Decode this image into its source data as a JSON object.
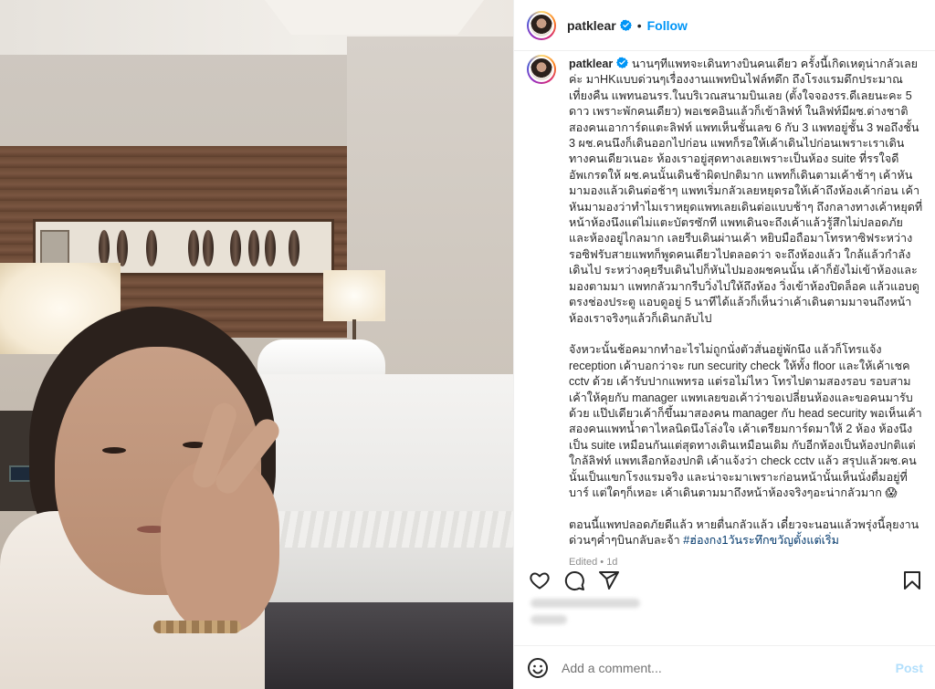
{
  "post": {
    "username": "patklear",
    "follow_label": "Follow",
    "separator": "•",
    "caption_paragraph_1": "นานๆทีแพทจะเดินทางบินคนเดียว ครั้งนี้เกิดเหตุน่ากลัวเลยค่ะ มาHKแบบด่วนๆเรื่องงานแพทบินไฟล์ทดึก ถึงโรงแรมดึกประมาณเที่ยงคืน แพทนอนรร.ในบริเวณสนามบินเลย (ตั้งใจจองรร.ดีเลยนะคะ 5 ดาว เพราะพักคนเดียว) พอเชคอินแล้วก็เข้าลิฟท์ ในลิฟท์มีผช.ต่างชาติสองคนเอาการ์ดแตะลิฟท์ แพทเห็นชั้นเลข 6 กับ 3 แพทอยู่ชั้น 3 พอถึงชั้น 3 ผช.คนนึงก็เดินออกไปก่อน แพทก็รอให้เค้าเดินไปก่อนเพราะเราเดินทางคนเดียวเนอะ ห้องเราอยู่สุดทางเลยเพราะเป็นห้อง suite ที่รรใจดีอัพเกรดให้ ผช.คนนั้นเดินช้าผิดปกติมาก แพทก็เดินตามเค้าช้าๆ เค้าหันมามองแล้วเดินต่อช้าๆ แพทเริ่มกลัวเลยหยุดรอให้เค้าถึงห้องเค้าก่อน เค้าหันมามองว่าทำไมเราหยุดแพทเลยเดินต่อแบบช้าๆ ถึงกลางทางเค้าหยุดที่หน้าห้องนึงแต่ไม่แตะบัตรซักที แพทเดินจะถึงเค้าแล้วรู้สึกไม่ปลอดภัยและห้องอยู่ไกลมาก เลยรีบเดินผ่านเค้า หยิบมือถือมาโทรหาซิฟระหว่างรอซิฟรับสายแพทก็พูดคนเดียวไปตลอดว่า จะถึงห้องแล้ว ใกล้แล้วกำลังเดินไป ระหว่างคุยรีบเดินไปก็หันไปมองผชคนนั้น เค้าก็ยังไม่เข้าห้องและมองตามมา แพทกลัวมากรีบวิ่งไปให้ถึงห้อง วิ่งเข้าห้องปิดล็อค แล้วแอบดูตรงช่องประตู แอบดูอยู่ 5 นาทีได้แล้วก็เห็นว่าเค้าเดินตามมาจนถึงหน้าห้องเราจริงๆแล้วก็เดินกลับไป",
    "caption_paragraph_2": "จังหวะนั้นช้อคมากทำอะไรไม่ถูกนั่งตัวสั่นอยู่พักนึง แล้วก็โทรแจ้ง reception เค้าบอกว่าจะ run security check ให้ทั้ง floor และให้เค้าเชค cctv ด้วย เค้ารับปากแพทรอ แต่รอไม่ไหว โทรไปตามสองรอบ รอบสามเค้าให้คุยกับ manager แพทเลยขอเค้าว่าขอเปลี่ยนห้องและขอคนมารับด้วย แป๊ปเดียวเค้าก็ขึ้นมาสองคน manager กับ head security พอเห็นเค้าสองคนแพทน้ำตาไหลนิดนึงโล่งใจ เค้าเตรียมการ์ดมาให้ 2 ห้อง ห้องนึงเป็น suite เหมือนกันแต่สุดทางเดินเหมือนเดิม กับอีกห้องเป็นห้องปกติแต่ใกล้ลิฟท์ แพทเลือกห้องปกติ เค้าแจ้งว่า check cctv แล้ว สรุปแล้วผช.คนนั้นเป็นแขกโรงแรมจริง และน่าจะมาเพราะก่อนหน้านั้นเห็นนั่งดื่มอยู่ที่บาร์ แต่ใดๆก็เหอะ เค้าเดินตามมาถึงหน้าห้องจริงๆอะน่ากลัวมาก 😱",
    "caption_paragraph_3": "ตอนนี้แพทปลอดภัยดีแล้ว หายตื่นกลัวแล้ว เดี๋ยวจะนอนแล้วพรุ่งนี้ลุยงานด่วนๆค่ำๆบินกลับละจ้า ",
    "hashtag": "#ฮ่องกง1วันระทึกขวัญตั้งแต่เริ่ม",
    "edited_label": "Edited",
    "time_ago": "1d",
    "comment_placeholder": "Add a comment...",
    "post_label": "Post"
  },
  "icons": {
    "verified": "verified-badge-icon",
    "like": "heart-icon",
    "comment": "comment-icon",
    "share": "share-icon",
    "save": "bookmark-icon",
    "emoji": "emoji-icon"
  },
  "colors": {
    "accent": "#0095f6",
    "text": "#262626",
    "muted": "#8e8e8e",
    "hashtag": "#00376b",
    "post_disabled": "#b2dffc"
  }
}
